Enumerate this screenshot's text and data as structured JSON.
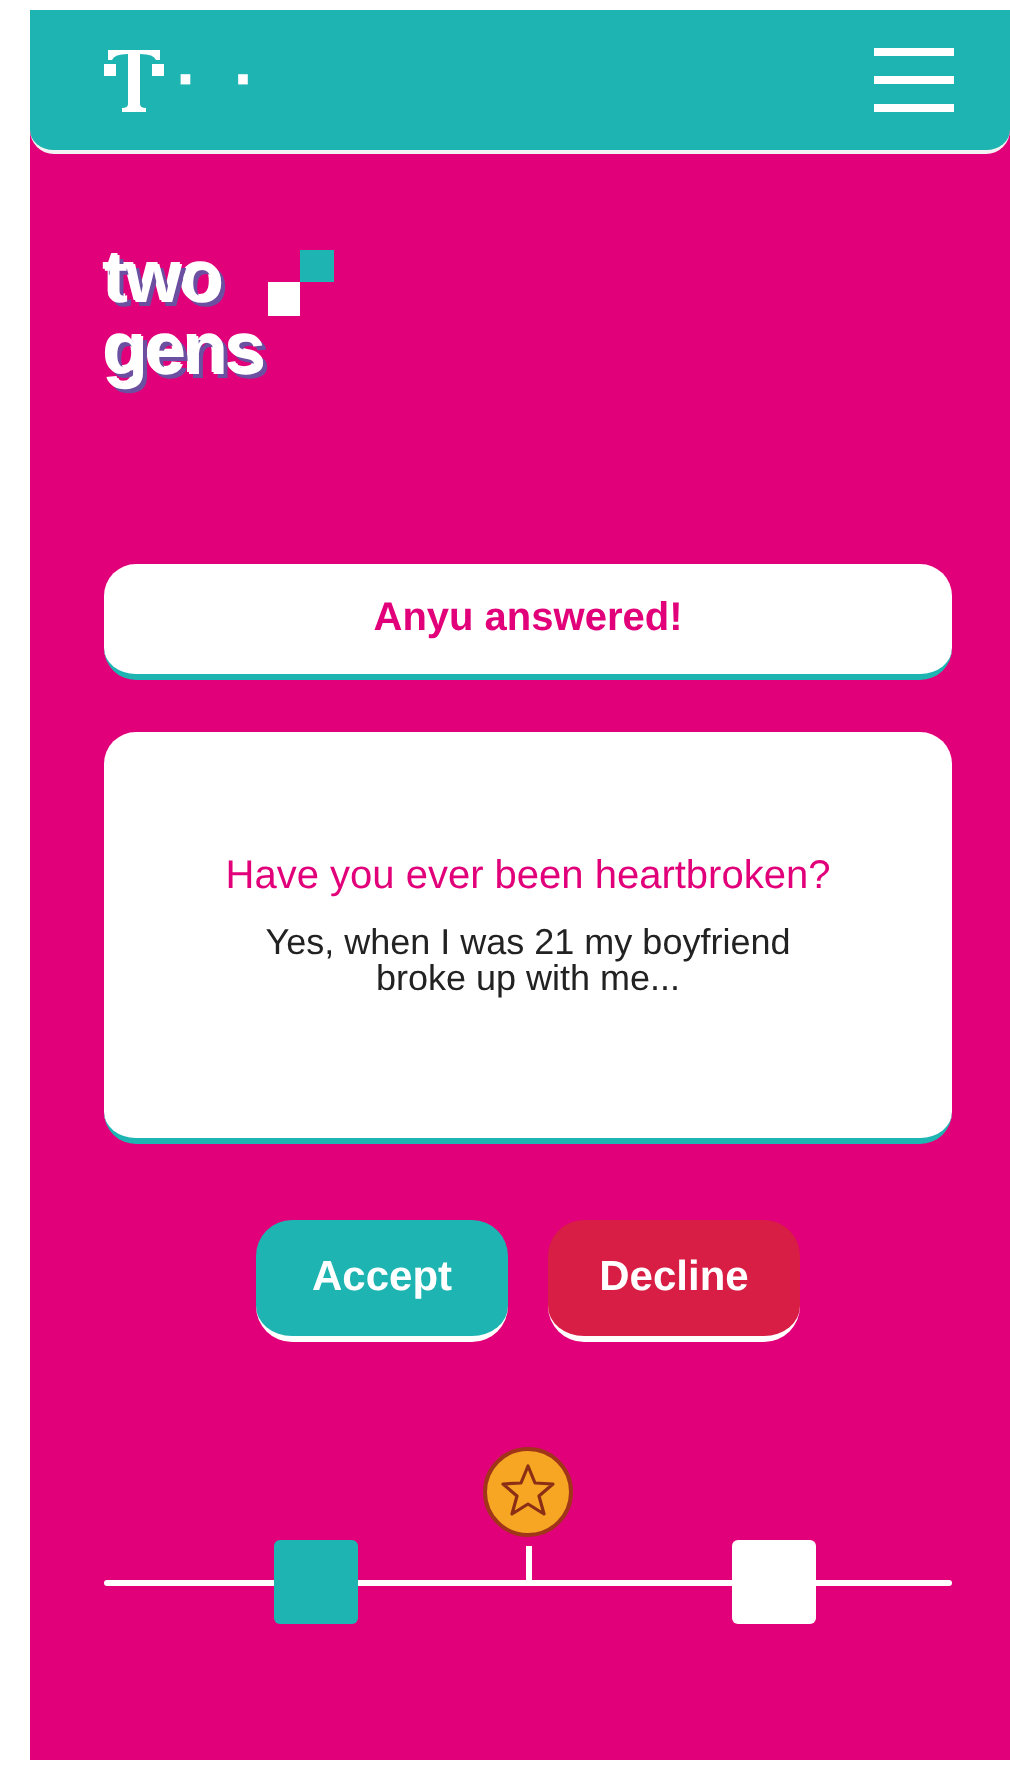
{
  "header": {
    "logo_dots": "· ·"
  },
  "logo": {
    "line_1": "two",
    "line_2": "gens"
  },
  "banner": {
    "text": "Anyu answered!"
  },
  "question_card": {
    "question": "Have you ever been heartbroken?",
    "answer": "Yes, when I was 21 my boyfriend broke up with me..."
  },
  "buttons": [
    {
      "label": "Accept",
      "kind": "accept"
    },
    {
      "label": "Decline",
      "kind": "decline"
    }
  ],
  "progress": {
    "markers": [
      {
        "level": 0.25,
        "color": "#1eb4b2"
      },
      {
        "level": 0.79,
        "color": "#ffffff"
      }
    ]
  }
}
